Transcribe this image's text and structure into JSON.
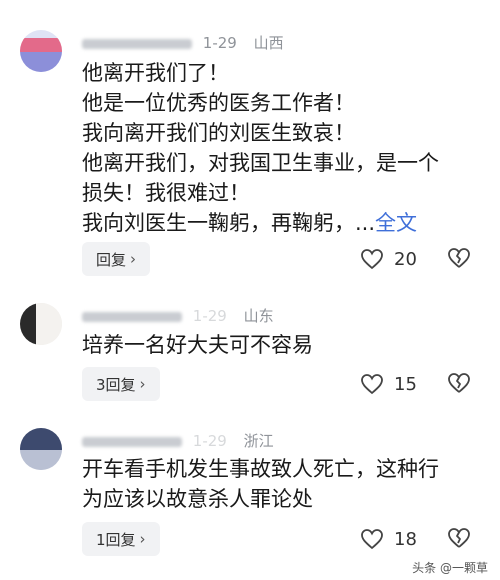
{
  "comments": [
    {
      "date": "1-29",
      "location": "山西",
      "lines": [
        "他离开我们了！",
        "他是一位优秀的医务工作者！",
        "我向离开我们的刘医生致哀！",
        "他离开我们，对我国卫生事业，是一个",
        "损失！我很难过！",
        "我向刘医生一鞠躬，再鞠躬，..."
      ],
      "full_text_link": "全文",
      "reply_label": "回复",
      "likes": "20"
    },
    {
      "date": "1-29",
      "location": "山东",
      "lines": [
        "培养一名好大夫可不容易"
      ],
      "reply_label": "3回复",
      "likes": "15"
    },
    {
      "date": "1-29",
      "location": "浙江",
      "lines": [
        "开车看手机发生事故致人死亡，这种行",
        "为应该以故意杀人罪论处"
      ],
      "reply_label": "1回复",
      "likes": "18"
    }
  ],
  "watermark": "头条 @一颗草",
  "colors": {
    "link": "#3f6fd9",
    "meta": "#8f9399",
    "reply_bg": "#f1f2f4"
  }
}
